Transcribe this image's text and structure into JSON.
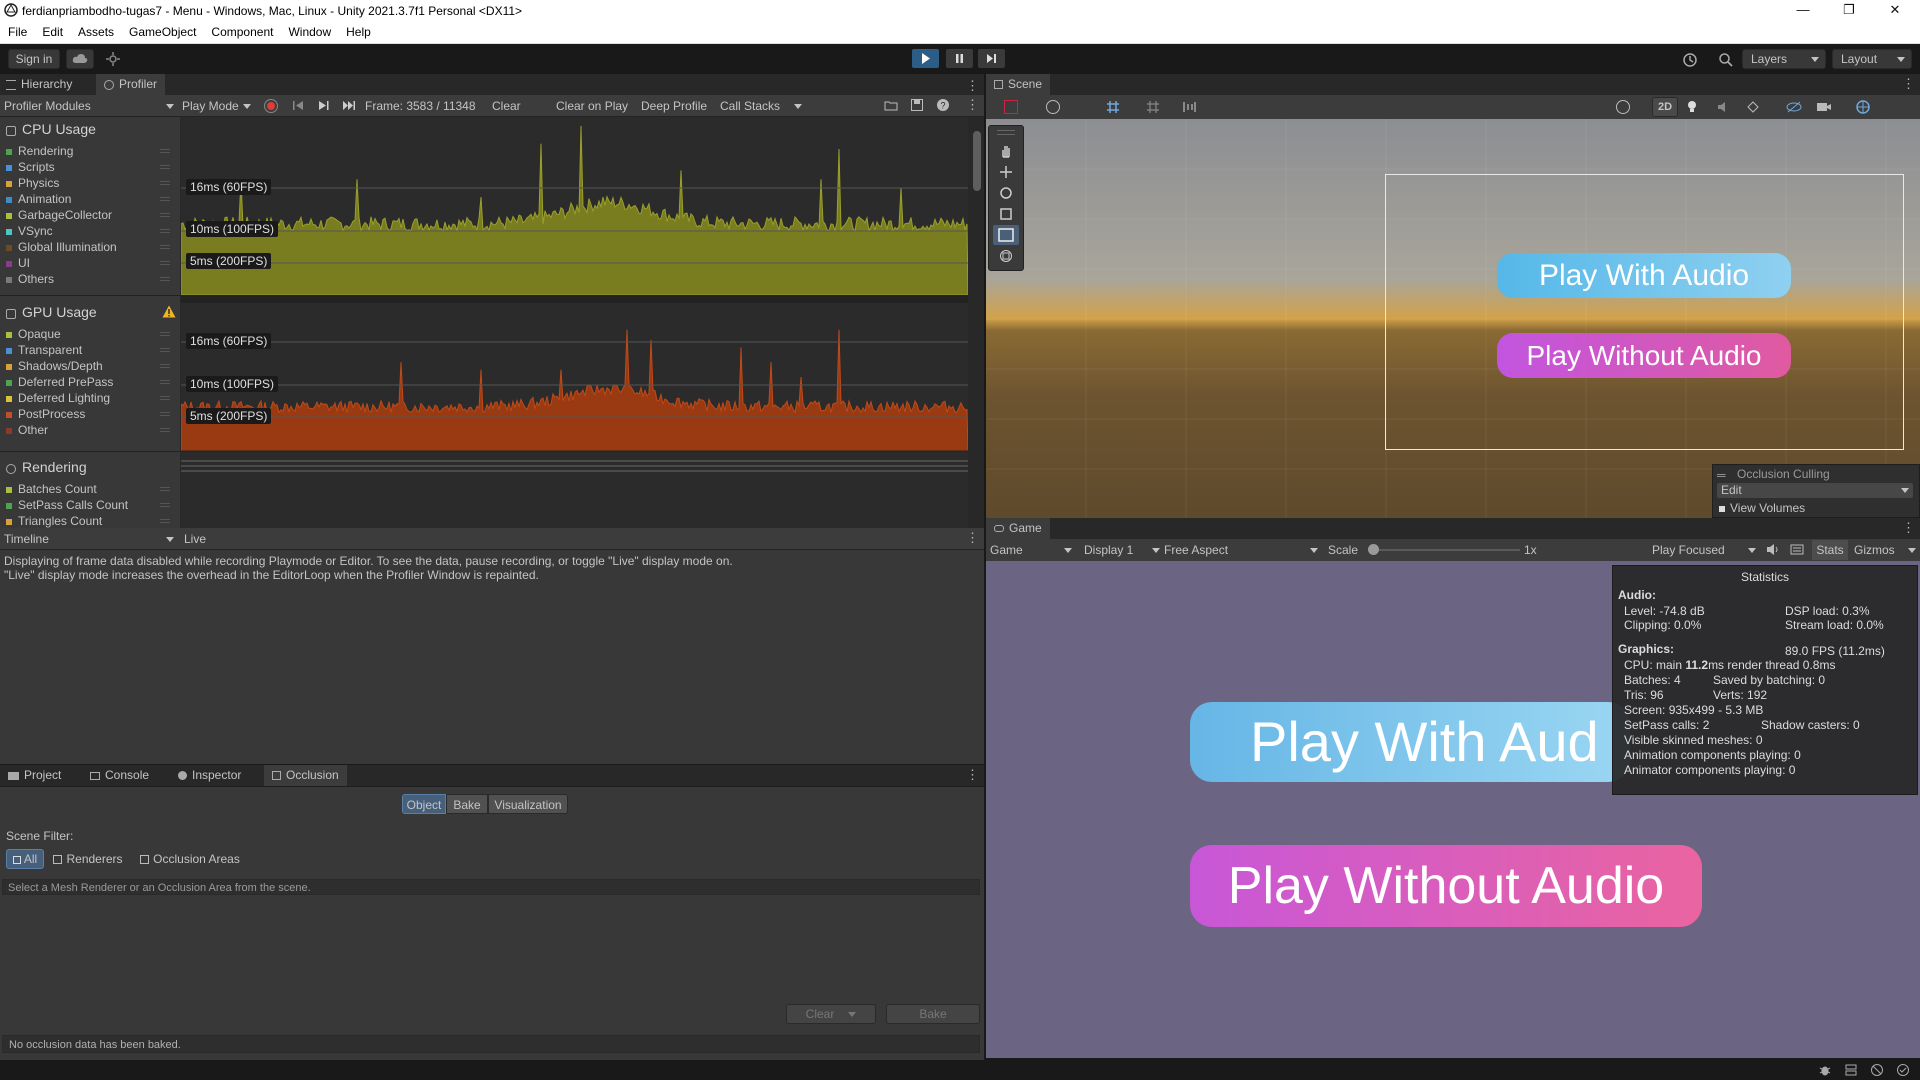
{
  "window": {
    "title": "ferdianpriambodho-tugas7 - Menu - Windows, Mac, Linux - Unity 2021.3.7f1 Personal <DX11>",
    "controls": [
      "—",
      "❐",
      "✕"
    ]
  },
  "menu": [
    "File",
    "Edit",
    "Assets",
    "GameObject",
    "Component",
    "Window",
    "Help"
  ],
  "toolbar": {
    "sign_in": "Sign in",
    "layers": "Layers",
    "layout": "Layout"
  },
  "profiler_panel": {
    "tabs": [
      "Hierarchy",
      "Profiler"
    ],
    "modules_label": "Profiler Modules",
    "play_mode": "Play Mode",
    "frame": "Frame: 3583 / 11348",
    "clear": "Clear",
    "clear_on_play": "Clear on Play",
    "deep_profile": "Deep Profile",
    "call_stacks": "Call Stacks",
    "cpu": {
      "title": "CPU Usage",
      "items": [
        {
          "label": "Rendering",
          "color": "#4ea34e"
        },
        {
          "label": "Scripts",
          "color": "#4a90d9"
        },
        {
          "label": "Physics",
          "color": "#d8a23a"
        },
        {
          "label": "Animation",
          "color": "#3b8ec9"
        },
        {
          "label": "GarbageCollector",
          "color": "#a8c040"
        },
        {
          "label": "VSync",
          "color": "#4dc5c5"
        },
        {
          "label": "Global Illumination",
          "color": "#6b4b2a"
        },
        {
          "label": "UI",
          "color": "#8b3a8b"
        },
        {
          "label": "Others",
          "color": "#7a7a7a"
        }
      ],
      "fps_labels": [
        "16ms (60FPS)",
        "10ms (100FPS)",
        "5ms (200FPS)"
      ]
    },
    "gpu": {
      "title": "GPU Usage",
      "items": [
        {
          "label": "Opaque",
          "color": "#a8c040"
        },
        {
          "label": "Transparent",
          "color": "#4a90d9"
        },
        {
          "label": "Shadows/Depth",
          "color": "#d8a23a"
        },
        {
          "label": "Deferred PrePass",
          "color": "#4ea34e"
        },
        {
          "label": "Deferred Lighting",
          "color": "#d8c23a"
        },
        {
          "label": "PostProcess",
          "color": "#c0502a"
        },
        {
          "label": "Other",
          "color": "#8b3a2a"
        }
      ],
      "fps_labels": [
        "16ms (60FPS)",
        "10ms (100FPS)",
        "5ms (200FPS)"
      ]
    },
    "rendering": {
      "title": "Rendering",
      "items": [
        {
          "label": "Batches Count",
          "color": "#a8c040"
        },
        {
          "label": "SetPass Calls Count",
          "color": "#4ea34e"
        },
        {
          "label": "Triangles Count",
          "color": "#d8a23a"
        }
      ]
    },
    "timeline": "Timeline",
    "live": "Live",
    "message_line1": "Displaying of frame data disabled while recording Playmode or Editor. To see the data, pause recording, or toggle \"Live\" display mode on.",
    "message_line2": "\"Live\" display mode increases the overhead in the EditorLoop when the Profiler Window is repainted."
  },
  "bottom_panel": {
    "tabs": [
      "Project",
      "Console",
      "Inspector",
      "Occlusion"
    ],
    "segments": [
      "Object",
      "Bake",
      "Visualization"
    ],
    "scene_filter": "Scene Filter:",
    "filters": [
      "All",
      "Renderers",
      "Occlusion Areas"
    ],
    "hint": "Select a Mesh Renderer or an Occlusion Area from the scene.",
    "clear": "Clear",
    "bake": "Bake",
    "status": "No occlusion data has been baked."
  },
  "scene": {
    "tab": "Scene",
    "btn1": "Play With Audio",
    "btn2": "Play Without Audio",
    "occlusion_title": "Occlusion Culling",
    "occlusion_mode": "Edit",
    "view_volumes": "View Volumes",
    "two_d": "2D"
  },
  "game": {
    "tab": "Game",
    "game_dd": "Game",
    "display": "Display 1",
    "aspect": "Free Aspect",
    "scale_label": "Scale",
    "scale_value": "1x",
    "play_focused": "Play Focused",
    "stats": "Stats",
    "gizmos": "Gizmos",
    "btn1": "Play With Aud",
    "btn2": "Play Without Audio",
    "statistics": {
      "title": "Statistics",
      "audio": "Audio:",
      "level": "Level: -74.8 dB",
      "dsp": "DSP load: 0.3%",
      "clipping": "Clipping: 0.0%",
      "stream": "Stream load: 0.0%",
      "graphics": "Graphics:",
      "fps": "89.0 FPS (11.2ms)",
      "cpu_main_prefix": "CPU: main ",
      "cpu_main_value": "11.2",
      "cpu_main_suffix": "ms  render thread 0.8ms",
      "batches": "Batches: 4",
      "saved": "Saved by batching: 0",
      "tris": "Tris: 96",
      "verts": "Verts: 192",
      "screen": "Screen: 935x499 - 5.3 MB",
      "setpass": "SetPass calls: 2",
      "shadow": "Shadow casters: 0",
      "skinned": "Visible skinned meshes: 0",
      "anim": "Animation components playing: 0",
      "animator": "Animator components playing: 0"
    }
  }
}
